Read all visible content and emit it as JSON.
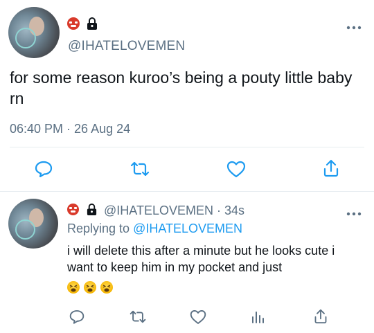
{
  "main_tweet": {
    "handle": "@IHATELOVEMEN",
    "text": "for some reason kuroo’s being a pouty little baby rn",
    "timestamp": "06:40 PM · 26 Aug 24"
  },
  "reply": {
    "handle_time": "@IHATELOVEMEN · 34s",
    "replying_prefix": "Replying to ",
    "replying_to": "@IHATELOVEMEN",
    "text": "i will delete this after a minute but he looks cute i want to keep him in my pocket and just",
    "emoji": [
      "tired-face-emoji",
      "tired-face-emoji",
      "tired-face-emoji"
    ]
  },
  "colors": {
    "accent": "#1d9bf0",
    "secondary_text": "#5b7083",
    "divider": "#e6ecf0"
  }
}
